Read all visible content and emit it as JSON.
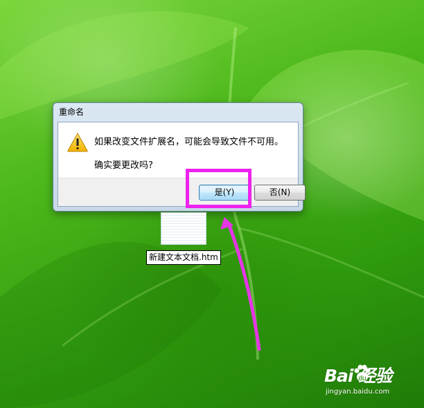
{
  "desktop": {
    "wallpaper": "green-clover-leaf",
    "file": {
      "name": "新建文本文档.htm",
      "icon": "text-document-icon"
    }
  },
  "dialog": {
    "title": "重命名",
    "icon": "warning-icon",
    "message_line1": "如果改变文件扩展名，可能会导致文件不可用。",
    "message_line2": "确实要更改吗?",
    "buttons": {
      "yes": "是(Y)",
      "no": "否(N)"
    }
  },
  "annotation": {
    "highlight_color": "#ee22ee",
    "arrow_color": "#e535e5"
  },
  "watermark": {
    "logo_text": "Bai 经验",
    "url": "jingyan.baidu.com"
  }
}
